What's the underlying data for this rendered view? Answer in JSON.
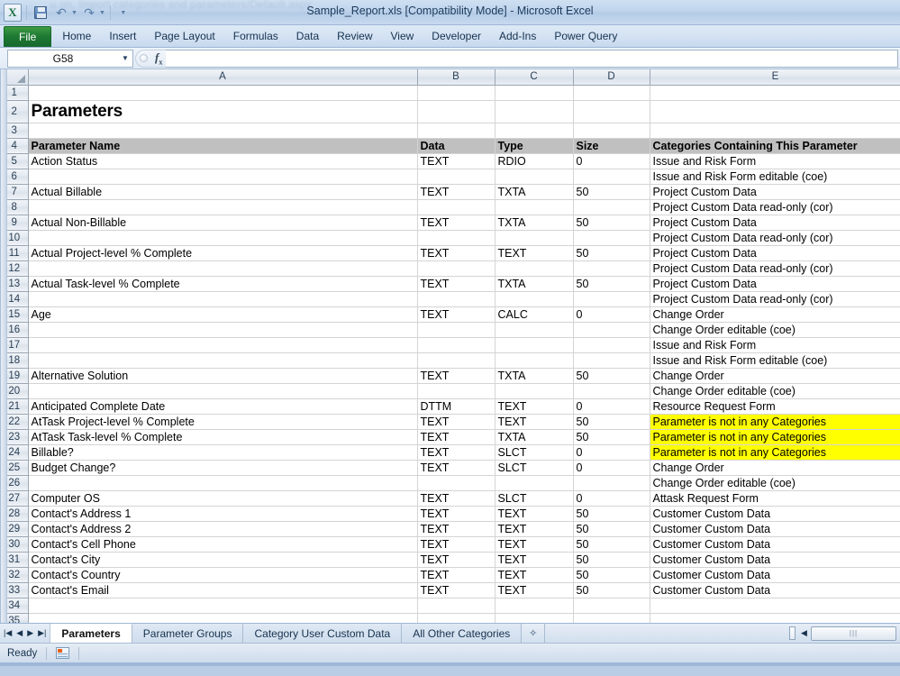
{
  "titlebar": {
    "ghost_url": "u on, Import categories and parameters/Default.aspx",
    "window_title": "Sample_Report.xls  [Compatibility Mode] - Microsoft Excel",
    "qat": [
      {
        "name": "excel-logo",
        "label": "X"
      },
      {
        "name": "save-icon",
        "label": "Save"
      },
      {
        "name": "undo-icon",
        "label": "↶"
      },
      {
        "name": "redo-icon",
        "label": "↷"
      },
      {
        "name": "customize-qat-icon",
        "label": "▾"
      }
    ]
  },
  "ribbon": {
    "file_tab": "File",
    "tabs": [
      "Home",
      "Insert",
      "Page Layout",
      "Formulas",
      "Data",
      "Review",
      "View",
      "Developer",
      "Add-Ins",
      "Power Query"
    ]
  },
  "formula_bar": {
    "name_box_value": "G58",
    "name_box_caret": "▼",
    "fx_label": "fx",
    "formula_value": "",
    "formula_placeholder": ""
  },
  "grid": {
    "column_headers": [
      "A",
      "B",
      "C",
      "D",
      "E"
    ],
    "rows": [
      {
        "n": "1",
        "type": "blank",
        "cells": [
          "",
          "",
          "",
          "",
          ""
        ]
      },
      {
        "n": "2",
        "type": "title",
        "cells": [
          "Parameters",
          "",
          "",
          "",
          ""
        ]
      },
      {
        "n": "3",
        "type": "blank",
        "cells": [
          "",
          "",
          "",
          "",
          ""
        ]
      },
      {
        "n": "4",
        "type": "header",
        "cells": [
          "Parameter Name",
          "Data",
          "Type",
          "Size",
          "Categories Containing This Parameter"
        ]
      },
      {
        "n": "5",
        "type": "data",
        "cells": [
          "Action Status",
          "TEXT",
          "RDIO",
          "0",
          "Issue and Risk Form"
        ]
      },
      {
        "n": "6",
        "type": "data",
        "cells": [
          "",
          "",
          "",
          "",
          "Issue and Risk Form editable (coe)"
        ]
      },
      {
        "n": "7",
        "type": "data",
        "cells": [
          "Actual Billable",
          "TEXT",
          "TXTA",
          "50",
          "Project Custom Data"
        ]
      },
      {
        "n": "8",
        "type": "data",
        "cells": [
          "",
          "",
          "",
          "",
          "Project Custom Data read-only (cor)"
        ]
      },
      {
        "n": "9",
        "type": "data",
        "cells": [
          "Actual Non-Billable",
          "TEXT",
          "TXTA",
          "50",
          "Project Custom Data"
        ]
      },
      {
        "n": "10",
        "type": "data",
        "cells": [
          "",
          "",
          "",
          "",
          "Project Custom Data read-only (cor)"
        ]
      },
      {
        "n": "11",
        "type": "data",
        "cells": [
          "Actual Project-level % Complete",
          "TEXT",
          "TEXT",
          "50",
          "Project Custom Data"
        ]
      },
      {
        "n": "12",
        "type": "data",
        "cells": [
          "",
          "",
          "",
          "",
          "Project Custom Data read-only (cor)"
        ]
      },
      {
        "n": "13",
        "type": "data",
        "cells": [
          "Actual Task-level % Complete",
          "TEXT",
          "TXTA",
          "50",
          "Project Custom Data"
        ]
      },
      {
        "n": "14",
        "type": "data",
        "cells": [
          "",
          "",
          "",
          "",
          "Project Custom Data read-only (cor)"
        ]
      },
      {
        "n": "15",
        "type": "data",
        "cells": [
          "Age",
          "TEXT",
          "CALC",
          "0",
          "Change Order"
        ]
      },
      {
        "n": "16",
        "type": "data",
        "cells": [
          "",
          "",
          "",
          "",
          "Change Order editable (coe)"
        ]
      },
      {
        "n": "17",
        "type": "data",
        "cells": [
          "",
          "",
          "",
          "",
          "Issue and Risk Form"
        ]
      },
      {
        "n": "18",
        "type": "data",
        "cells": [
          "",
          "",
          "",
          "",
          "Issue and Risk Form editable (coe)"
        ]
      },
      {
        "n": "19",
        "type": "data",
        "cells": [
          "Alternative Solution",
          "TEXT",
          "TXTA",
          "50",
          "Change Order"
        ]
      },
      {
        "n": "20",
        "type": "data",
        "cells": [
          "",
          "",
          "",
          "",
          "Change Order editable (coe)"
        ]
      },
      {
        "n": "21",
        "type": "data",
        "cells": [
          "Anticipated Complete Date",
          "DTTM",
          "TEXT",
          "0",
          "Resource Request Form"
        ]
      },
      {
        "n": "22",
        "type": "data",
        "cells": [
          "AtTask Project-level % Complete",
          "TEXT",
          "TEXT",
          "50",
          "Parameter is not in any Categories"
        ],
        "highlight_e": true
      },
      {
        "n": "23",
        "type": "data",
        "cells": [
          "AtTask Task-level % Complete",
          "TEXT",
          "TXTA",
          "50",
          "Parameter is not in any Categories"
        ],
        "highlight_e": true
      },
      {
        "n": "24",
        "type": "data",
        "cells": [
          "Billable?",
          "TEXT",
          "SLCT",
          "0",
          "Parameter is not in any Categories"
        ],
        "highlight_e": true
      },
      {
        "n": "25",
        "type": "data",
        "cells": [
          "Budget Change?",
          "TEXT",
          "SLCT",
          "0",
          "Change Order"
        ]
      },
      {
        "n": "26",
        "type": "data",
        "cells": [
          "",
          "",
          "",
          "",
          "Change Order editable (coe)"
        ]
      },
      {
        "n": "27",
        "type": "data",
        "cells": [
          "Computer OS",
          "TEXT",
          "SLCT",
          "0",
          "Attask Request Form"
        ]
      },
      {
        "n": "28",
        "type": "data",
        "cells": [
          "Contact's Address 1",
          "TEXT",
          "TEXT",
          "50",
          "Customer Custom Data"
        ]
      },
      {
        "n": "29",
        "type": "data",
        "cells": [
          "Contact's Address 2",
          "TEXT",
          "TEXT",
          "50",
          "Customer Custom Data"
        ]
      },
      {
        "n": "30",
        "type": "data",
        "cells": [
          "Contact's Cell Phone",
          "TEXT",
          "TEXT",
          "50",
          "Customer Custom Data"
        ]
      },
      {
        "n": "31",
        "type": "data",
        "cells": [
          "Contact's City",
          "TEXT",
          "TEXT",
          "50",
          "Customer Custom Data"
        ]
      },
      {
        "n": "32",
        "type": "data",
        "cells": [
          "Contact's Country",
          "TEXT",
          "TEXT",
          "50",
          "Customer Custom Data"
        ]
      },
      {
        "n": "33",
        "type": "data",
        "cells": [
          "Contact's Email",
          "TEXT",
          "TEXT",
          "50",
          "Customer Custom Data"
        ]
      },
      {
        "n": "34",
        "type": "blank",
        "cells": [
          "",
          "",
          "",
          "",
          ""
        ]
      },
      {
        "n": "35",
        "type": "blank",
        "cells": [
          "",
          "",
          "",
          "",
          ""
        ]
      }
    ]
  },
  "sheet_tabs": {
    "nav": [
      "|◀",
      "◀",
      "▶",
      "▶|"
    ],
    "tabs": [
      {
        "label": "Parameters",
        "active": true
      },
      {
        "label": "Parameter Groups",
        "active": false
      },
      {
        "label": "Category User Custom Data",
        "active": false
      },
      {
        "label": "All Other Categories",
        "active": false
      }
    ],
    "new_sheet_label": "✧"
  },
  "hscroll": {
    "left_arrow": "◀",
    "thumb_grip": "|||"
  },
  "statusbar": {
    "mode": "Ready"
  },
  "colors": {
    "highlight_yellow": "#ffff00",
    "header_gray": "#c0c0c0",
    "file_tab_green": "#1f7a34",
    "chrome_blue": "#b9cde5"
  }
}
